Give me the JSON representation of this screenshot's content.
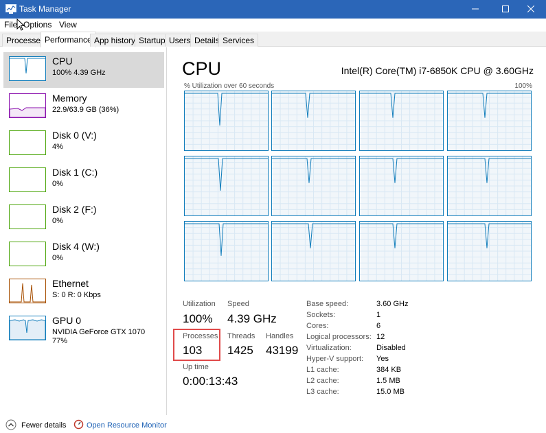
{
  "window": {
    "title": "Task Manager"
  },
  "menu": {
    "items": [
      "File",
      "Options",
      "View"
    ]
  },
  "tabs": [
    "Processes",
    "Performance",
    "App history",
    "Startup",
    "Users",
    "Details",
    "Services"
  ],
  "active_tab": "Performance",
  "resources": [
    {
      "name": "CPU",
      "sub": "100% 4.39 GHz",
      "color": "#117dbb"
    },
    {
      "name": "Memory",
      "sub": "22.9/63.9 GB (36%)",
      "color": "#8b12ae"
    },
    {
      "name": "Disk 0 (V:)",
      "sub": "4%",
      "color": "#4da60c"
    },
    {
      "name": "Disk 1 (C:)",
      "sub": "0%",
      "color": "#4da60c"
    },
    {
      "name": "Disk 2 (F:)",
      "sub": "0%",
      "color": "#4da60c"
    },
    {
      "name": "Disk 4 (W:)",
      "sub": "0%",
      "color": "#4da60c"
    },
    {
      "name": "Ethernet",
      "sub": "S: 0 R: 0 Kbps",
      "color": "#a74f01"
    },
    {
      "name": "GPU 0",
      "sub": "NVIDIA GeForce GTX 1070",
      "sub2": "77%",
      "color": "#117dbb"
    }
  ],
  "cpu": {
    "title": "CPU",
    "model": "Intel(R) Core(TM) i7-6850K CPU @ 3.60GHz",
    "graph_label": "% Utilization over 60 seconds",
    "graph_max": "100%"
  },
  "stats": {
    "utilization_label": "Utilization",
    "utilization": "100%",
    "speed_label": "Speed",
    "speed": "4.39 GHz",
    "processes_label": "Processes",
    "processes": "103",
    "threads_label": "Threads",
    "threads": "1425",
    "handles_label": "Handles",
    "handles": "43199",
    "uptime_label": "Up time",
    "uptime": "0:00:13:43"
  },
  "specs": [
    {
      "label": "Base speed:",
      "value": "3.60 GHz"
    },
    {
      "label": "Sockets:",
      "value": "1"
    },
    {
      "label": "Cores:",
      "value": "6"
    },
    {
      "label": "Logical processors:",
      "value": "12"
    },
    {
      "label": "Virtualization:",
      "value": "Disabled"
    },
    {
      "label": "Hyper-V support:",
      "value": "Yes"
    },
    {
      "label": "L1 cache:",
      "value": "384 KB"
    },
    {
      "label": "L2 cache:",
      "value": "1.5 MB"
    },
    {
      "label": "L3 cache:",
      "value": "15.0 MB"
    }
  ],
  "footer": {
    "fewer_details": "Fewer details",
    "open_monitor": "Open Resource Monitor"
  }
}
